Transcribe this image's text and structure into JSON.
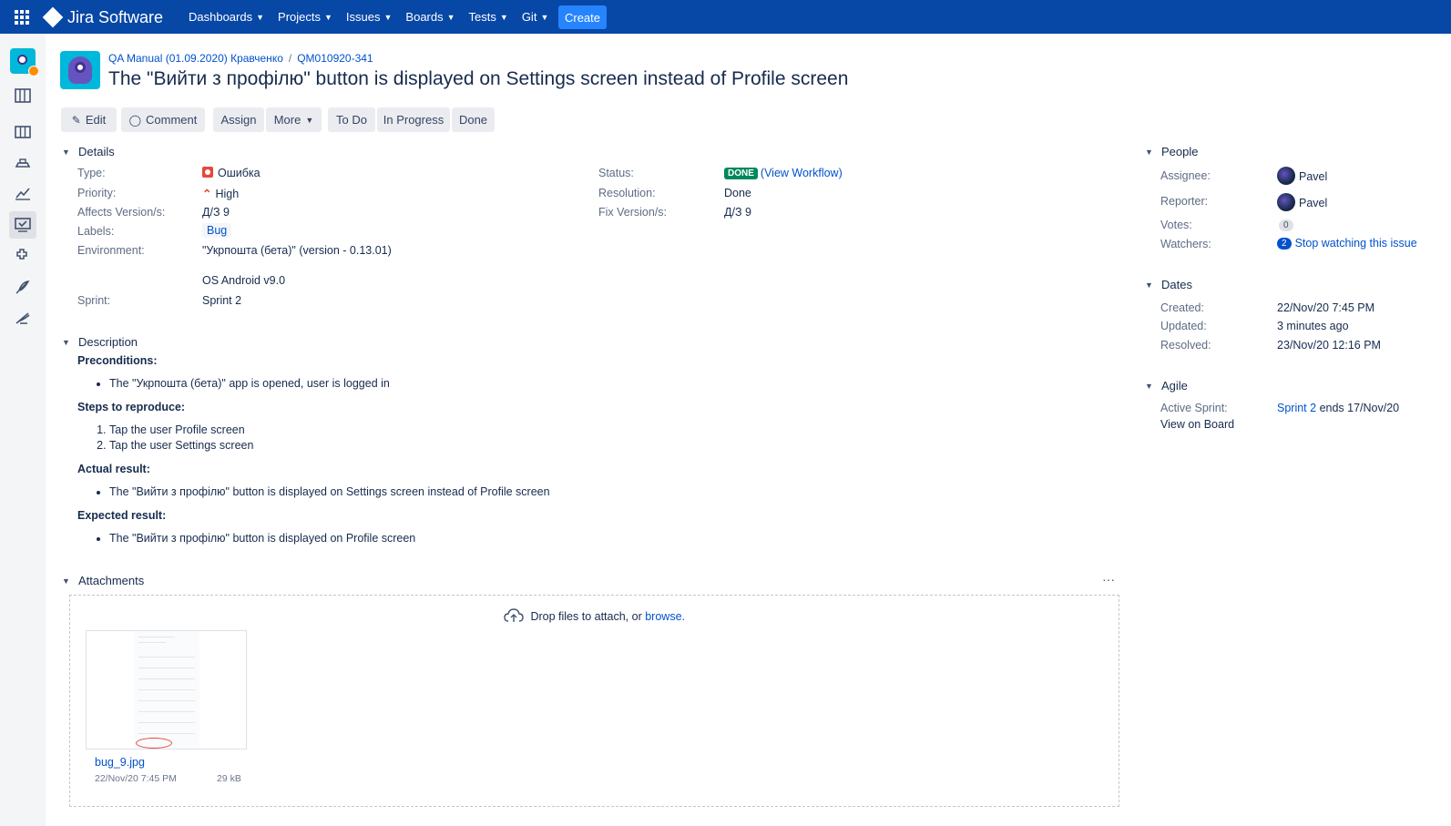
{
  "nav": {
    "brand": "Jira Software",
    "menu": [
      {
        "label": "Dashboards"
      },
      {
        "label": "Projects"
      },
      {
        "label": "Issues"
      },
      {
        "label": "Boards"
      },
      {
        "label": "Tests"
      },
      {
        "label": "Git"
      }
    ],
    "create_label": "Create"
  },
  "sidebar": {
    "icons": [
      "project-avatar-icon",
      "backlog-icon",
      "board-icon",
      "releases-icon",
      "reports-icon",
      "issues-icon",
      "components-icon",
      "feather-icon",
      "plugin-icon"
    ]
  },
  "breadcrumb": {
    "project": "QA Manual (01.09.2020) Кравченко",
    "separator": "/",
    "issue_key": "QM010920-341"
  },
  "issue": {
    "title": "The \"Вийти з профілю\" button is displayed on Settings screen instead of Profile screen"
  },
  "toolbar": {
    "edit": "Edit",
    "comment": "Comment",
    "assign": "Assign",
    "more": "More",
    "todo": "To Do",
    "in_progress": "In Progress",
    "done": "Done"
  },
  "details": {
    "heading": "Details",
    "type_label": "Type:",
    "type_value": "Ошибка",
    "priority_label": "Priority:",
    "priority_value": "High",
    "affects_label": "Affects Version/s:",
    "affects_value": "Д/З 9",
    "labels_label": "Labels:",
    "labels_value": "Bug",
    "environment_label": "Environment:",
    "environment_line1": "\"Укрпошта (бета)\" (version - 0.13.01)",
    "environment_line2": "OS Android v9.0",
    "sprint_label": "Sprint:",
    "sprint_value": "Sprint 2",
    "status_label": "Status:",
    "status_value": "DONE",
    "view_workflow": "(View Workflow)",
    "resolution_label": "Resolution:",
    "resolution_value": "Done",
    "fix_label": "Fix Version/s:",
    "fix_value": "Д/З 9"
  },
  "description": {
    "heading": "Description",
    "preconditions_h": "Preconditions:",
    "preconditions": [
      "The \"Укрпошта (бета)\" app is opened, user is logged in"
    ],
    "steps_h": "Steps to reproduce:",
    "steps": [
      "Tap the user Profile screen",
      "Tap the user Settings screen"
    ],
    "actual_h": "Actual result:",
    "actual": [
      "The \"Вийти з профілю\" button is displayed on Settings screen instead of Profile screen"
    ],
    "expected_h": "Expected result:",
    "expected": [
      "The \"Вийти з профілю\" button is displayed on Profile screen"
    ]
  },
  "attachments": {
    "heading": "Attachments",
    "more": "···",
    "drop_text": "Drop files to attach, or",
    "browse": "browse.",
    "files": [
      {
        "name": "bug_9.jpg",
        "date": "22/Nov/20 7:45 PM",
        "size": "29 kB"
      }
    ]
  },
  "people": {
    "heading": "People",
    "assignee_label": "Assignee:",
    "assignee": "Pavel",
    "reporter_label": "Reporter:",
    "reporter": "Pavel",
    "votes_label": "Votes:",
    "votes": "0",
    "watchers_label": "Watchers:",
    "watchers_count": "2",
    "watch_link": "Stop watching this issue"
  },
  "dates": {
    "heading": "Dates",
    "created_label": "Created:",
    "created": "22/Nov/20 7:45 PM",
    "updated_label": "Updated:",
    "updated": "3 minutes ago",
    "resolved_label": "Resolved:",
    "resolved": "23/Nov/20 12:16 PM"
  },
  "agile": {
    "heading": "Agile",
    "active_sprint_label": "Active Sprint:",
    "sprint_link": "Sprint 2",
    "sprint_suffix": "ends 17/Nov/20",
    "view_on_board": "View on Board"
  },
  "colors": {
    "nav_bg": "#0747a6",
    "create_bg": "#2684ff",
    "link": "#0052cc",
    "done_lozenge": "#00875a",
    "bug_type": "#e5493a"
  }
}
